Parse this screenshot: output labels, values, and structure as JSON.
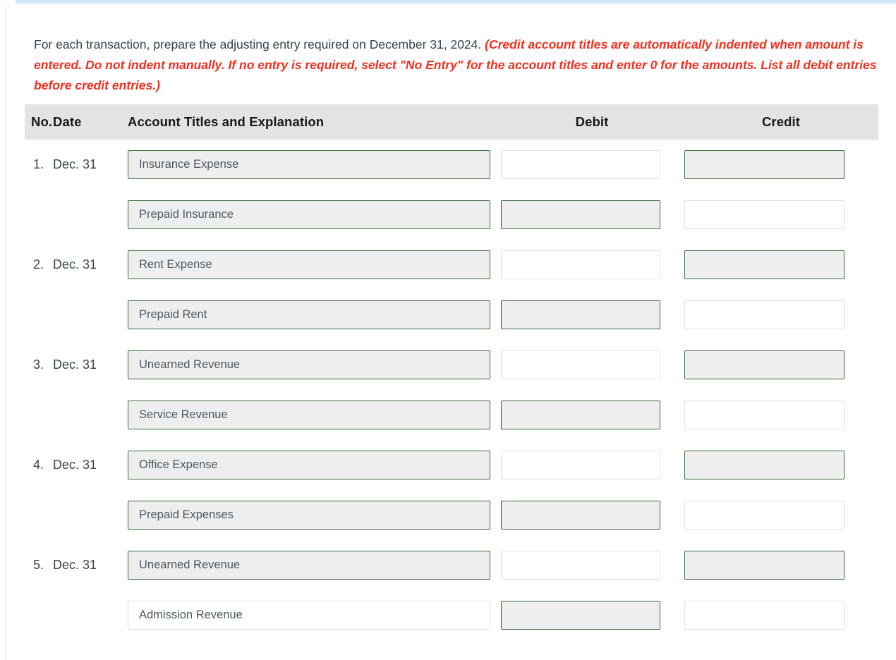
{
  "instructions": {
    "lead": "For each transaction, prepare the adjusting entry required on December 31, 2024.",
    "note": "(Credit account titles are automatically indented when amount is entered. Do not indent manually. If no entry is required, select \"No Entry\" for the account titles and enter 0 for the amounts. List all debit entries before credit entries.)"
  },
  "table": {
    "headers": {
      "no": "No.",
      "date": "Date",
      "account": "Account Titles and Explanation",
      "debit": "Debit",
      "credit": "Credit"
    },
    "rows": [
      {
        "no": "1.",
        "date": "Dec. 31",
        "lines": [
          {
            "account": "Insurance Expense",
            "account_state": "selected",
            "debit_value": "",
            "debit_state": "disabled",
            "credit_value": "",
            "credit_state": "enabled"
          },
          {
            "account": "Prepaid Insurance",
            "account_state": "selected",
            "debit_value": "",
            "debit_state": "enabled",
            "credit_value": "",
            "credit_state": "disabled"
          }
        ]
      },
      {
        "no": "2.",
        "date": "Dec. 31",
        "lines": [
          {
            "account": "Rent Expense",
            "account_state": "selected",
            "debit_value": "",
            "debit_state": "disabled",
            "credit_value": "",
            "credit_state": "enabled"
          },
          {
            "account": "Prepaid Rent",
            "account_state": "selected",
            "debit_value": "",
            "debit_state": "enabled",
            "credit_value": "",
            "credit_state": "disabled"
          }
        ]
      },
      {
        "no": "3.",
        "date": "Dec. 31",
        "lines": [
          {
            "account": "Unearned Revenue",
            "account_state": "selected",
            "debit_value": "",
            "debit_state": "disabled",
            "credit_value": "",
            "credit_state": "enabled"
          },
          {
            "account": "Service Revenue",
            "account_state": "selected",
            "debit_value": "",
            "debit_state": "enabled",
            "credit_value": "",
            "credit_state": "disabled"
          }
        ]
      },
      {
        "no": "4.",
        "date": "Dec. 31",
        "lines": [
          {
            "account": "Office Expense",
            "account_state": "selected",
            "debit_value": "",
            "debit_state": "disabled",
            "credit_value": "",
            "credit_state": "enabled"
          },
          {
            "account": "Prepaid Expenses",
            "account_state": "selected",
            "debit_value": "",
            "debit_state": "enabled",
            "credit_value": "",
            "credit_state": "disabled"
          }
        ]
      },
      {
        "no": "5.",
        "date": "Dec. 31",
        "lines": [
          {
            "account": "Unearned Revenue",
            "account_state": "selected",
            "debit_value": "",
            "debit_state": "disabled",
            "credit_value": "",
            "credit_state": "enabled"
          },
          {
            "account": "Admission Revenue",
            "account_state": "plain",
            "debit_value": "",
            "debit_state": "enabled",
            "credit_value": "",
            "credit_state": "disabled"
          }
        ]
      }
    ]
  },
  "colors": {
    "note_red": "#ea3323",
    "field_border_active": "#3d6b3c",
    "field_fill_active": "#eeeeee",
    "header_band": "#e3e3e3",
    "top_accent": "#cfe8f3"
  }
}
